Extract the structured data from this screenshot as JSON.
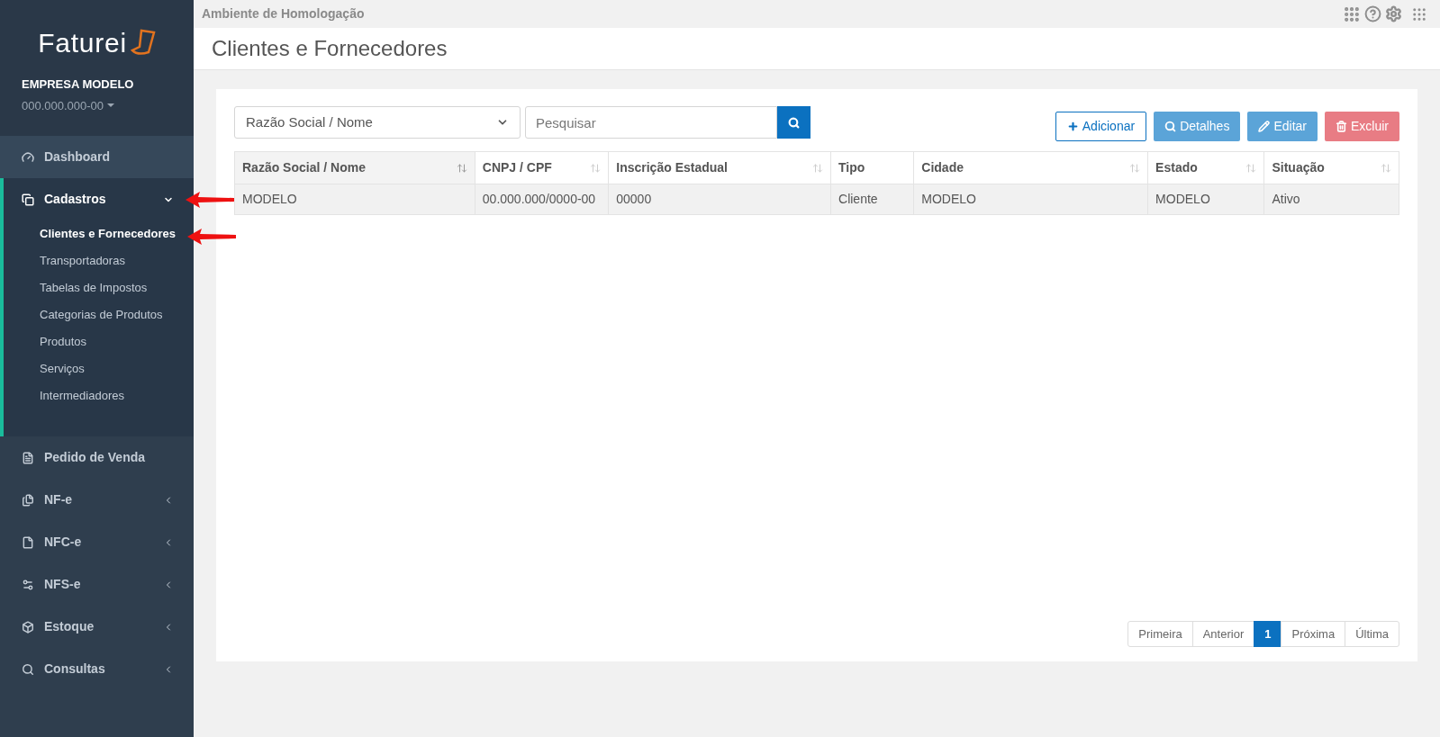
{
  "environment": "Ambiente de Homologação",
  "page_title": "Clientes e Fornecedores",
  "sidebar": {
    "logo": "Faturei",
    "company": "EMPRESA MODELO",
    "company_id": "000.000.000-00",
    "items": [
      {
        "label": "Dashboard",
        "hovered": true,
        "expanded": false
      },
      {
        "label": "Cadastros",
        "hovered": false,
        "expanded": true,
        "children": [
          {
            "label": "Clientes e Fornecedores",
            "selected": true
          },
          {
            "label": "Transportadoras",
            "selected": false
          },
          {
            "label": "Tabelas de Impostos",
            "selected": false
          },
          {
            "label": "Categorias de Produtos",
            "selected": false
          },
          {
            "label": "Produtos",
            "selected": false
          },
          {
            "label": "Serviços",
            "selected": false
          },
          {
            "label": "Intermediadores",
            "selected": false
          }
        ]
      },
      {
        "label": "Pedido de Venda",
        "hovered": false,
        "expanded": false
      },
      {
        "label": "NF-e",
        "hovered": false,
        "expanded": false
      },
      {
        "label": "NFC-e",
        "hovered": false,
        "expanded": false
      },
      {
        "label": "NFS-e",
        "hovered": false,
        "expanded": false
      },
      {
        "label": "Estoque",
        "hovered": false,
        "expanded": false
      },
      {
        "label": "Consultas",
        "hovered": false,
        "expanded": false
      }
    ]
  },
  "filter": {
    "field": "Razão Social / Nome",
    "search_placeholder": "Pesquisar"
  },
  "actions": [
    {
      "label": "Adicionar",
      "kind": "add"
    },
    {
      "label": "Detalhes",
      "kind": "details"
    },
    {
      "label": "Editar",
      "kind": "edit"
    },
    {
      "label": "Excluir",
      "kind": "delete"
    }
  ],
  "table": {
    "columns": [
      {
        "label": "Razão Social / Nome",
        "sortable": true,
        "sorted": true
      },
      {
        "label": "CNPJ / CPF",
        "sortable": true,
        "sorted": false
      },
      {
        "label": "Inscrição Estadual",
        "sortable": true,
        "sorted": false
      },
      {
        "label": "Tipo",
        "sortable": false,
        "sorted": false
      },
      {
        "label": "Cidade",
        "sortable": true,
        "sorted": false
      },
      {
        "label": "Estado",
        "sortable": true,
        "sorted": false
      },
      {
        "label": "Situação",
        "sortable": true,
        "sorted": false
      }
    ],
    "rows": [
      {
        "selected": true,
        "cells": [
          "MODELO",
          "00.000.000/0000-00",
          "00000",
          "Cliente",
          "MODELO",
          "MODELO",
          "Ativo"
        ]
      }
    ]
  },
  "pagination": [
    {
      "label": "Primeira",
      "selected": false
    },
    {
      "label": "Anterior",
      "selected": false
    },
    {
      "label": "1",
      "selected": true
    },
    {
      "label": "Próxima",
      "selected": false
    },
    {
      "label": "Última",
      "selected": false
    }
  ]
}
